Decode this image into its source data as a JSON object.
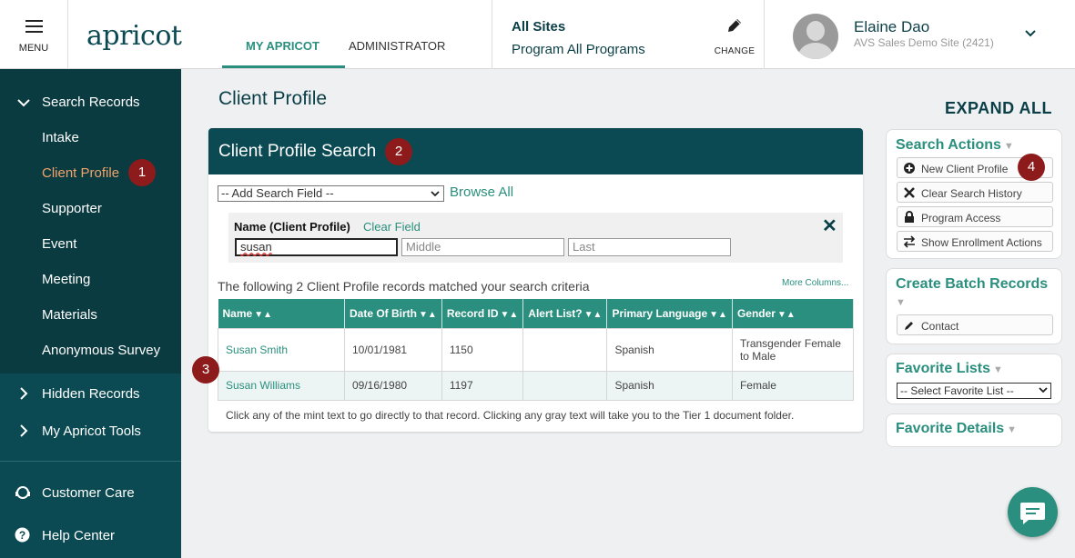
{
  "header": {
    "menu_label": "MENU",
    "logo": "apricot",
    "tabs": [
      "MY APRICOT",
      "ADMINISTRATOR"
    ],
    "site_title": "All Sites",
    "site_program": "Program All Programs",
    "change_label": "CHANGE",
    "user_name": "Elaine Dao",
    "user_site": "AVS Sales Demo Site (2421)"
  },
  "sidebar": {
    "search_records": "Search Records",
    "items": [
      "Intake",
      "Client Profile",
      "Supporter",
      "Event",
      "Meeting",
      "Materials",
      "Anonymous Survey"
    ],
    "hidden_records": "Hidden Records",
    "my_tools": "My Apricot Tools",
    "customer_care": "Customer Care",
    "help_center": "Help Center"
  },
  "badges": [
    "1",
    "2",
    "3",
    "4"
  ],
  "main": {
    "page_title": "Client Profile",
    "expand_all": "EXPAND ALL"
  },
  "search": {
    "title": "Client Profile Search",
    "add_field": "-- Add Search Field --",
    "browse_all": "Browse All",
    "field_name": "Name (Client Profile)",
    "clear_field": "Clear Field",
    "first_value": "susan",
    "middle_placeholder": "Middle",
    "last_placeholder": "Last",
    "matched_text": "The following 2 Client Profile records matched your search criteria",
    "more_columns": "More Columns...",
    "columns": [
      "Name",
      "Date Of Birth",
      "Record ID",
      "Alert List?",
      "Primary Language",
      "Gender"
    ],
    "rows": [
      [
        "Susan Smith",
        "10/01/1981",
        "1150",
        "",
        "Spanish",
        "Transgender Female to Male"
      ],
      [
        "Susan Williams",
        "09/16/1980",
        "1197",
        "",
        "Spanish",
        "Female"
      ]
    ],
    "footnote": "Click any of the mint text to go directly to that record. Clicking any gray text will take you to the Tier 1 document folder."
  },
  "actions": {
    "title": "Search Actions",
    "buttons": [
      "New Client Profile",
      "Clear Search History",
      "Program Access",
      "Show Enrollment Actions"
    ]
  },
  "batch": {
    "title": "Create Batch Records",
    "buttons": [
      "Contact"
    ]
  },
  "favorites": {
    "title": "Favorite Lists",
    "select": "-- Select Favorite List --"
  },
  "details": {
    "title": "Favorite Details"
  },
  "colors": {
    "teal_dark": "#0b4a52",
    "mint": "#2a8f7e",
    "badge": "#8e1b1b",
    "active": "#f0a36b"
  }
}
